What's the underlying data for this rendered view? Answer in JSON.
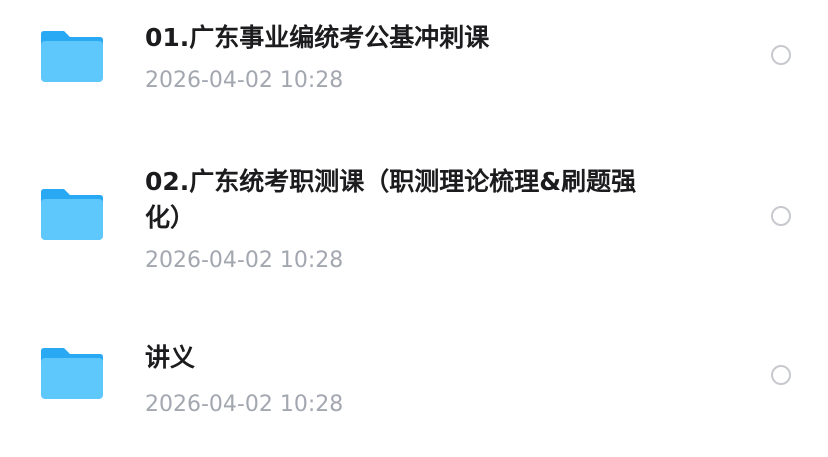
{
  "files": [
    {
      "name": "01.广东事业编统考公基冲刺课",
      "date": "2026-04-02 10:28",
      "icon": "folder-icon"
    },
    {
      "name": "02.广东统考职测课（职测理论梳理&刷题强化）",
      "date": "2026-04-02 10:28",
      "icon": "folder-icon"
    },
    {
      "name": "讲义",
      "date": "2026-04-02 10:28",
      "icon": "folder-icon"
    }
  ],
  "colors": {
    "folder_top": "#29a8f3",
    "folder_body": "#5ec8fc",
    "date_text": "#a3a7b0",
    "name_text": "#1c1c1e",
    "circle_border": "#c7c9ce"
  }
}
